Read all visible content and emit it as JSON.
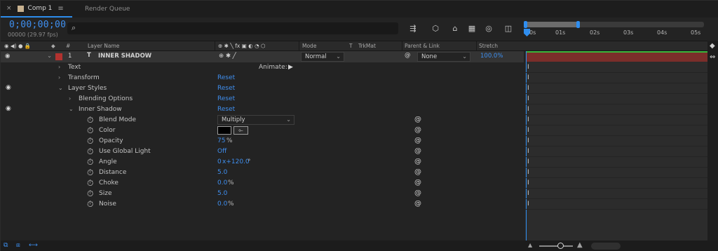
{
  "tabs": [
    {
      "label": "Comp 1",
      "active": true
    },
    {
      "label": "Render Queue",
      "active": false
    }
  ],
  "timecode": "0;00;00;00",
  "fps": "00000 (29.97 fps)",
  "search": {
    "placeholder": ""
  },
  "columns": {
    "num": "#",
    "layer_name": "Layer Name",
    "mode": "Mode",
    "t": "T",
    "trkmat": "TrkMat",
    "parent": "Parent & Link",
    "stretch": "Stretch"
  },
  "ruler": {
    "ticks": [
      "0s",
      "01s",
      "02s",
      "03s",
      "04s",
      "05s"
    ]
  },
  "layer": {
    "number": "1",
    "type_glyph": "T",
    "name": "INNER SHADOW",
    "color": "#b2322f",
    "mode": "Normal",
    "parent": "None",
    "stretch": "100.0%"
  },
  "properties": {
    "text": "Text",
    "animate_label": "Animate:",
    "transform": "Transform",
    "transform_reset": "Reset",
    "layer_styles": "Layer Styles",
    "layer_styles_reset": "Reset",
    "blending_options": "Blending Options",
    "blending_reset": "Reset",
    "inner_shadow": "Inner Shadow",
    "inner_shadow_reset": "Reset"
  },
  "inner_shadow_props": {
    "blend_mode": {
      "label": "Blend Mode",
      "value": "Multiply"
    },
    "color": {
      "label": "Color",
      "value": "#000000"
    },
    "opacity": {
      "label": "Opacity",
      "value": "75",
      "unit": "%"
    },
    "use_global_light": {
      "label": "Use Global Light",
      "value": "Off"
    },
    "angle": {
      "label": "Angle",
      "value": "0",
      "value2": "x+120.0",
      "unit": "°"
    },
    "distance": {
      "label": "Distance",
      "value": "5.0"
    },
    "choke": {
      "label": "Choke",
      "value": "0.0",
      "unit": "%"
    },
    "size": {
      "label": "Size",
      "value": "5.0"
    },
    "noise": {
      "label": "Noise",
      "value": "0.0",
      "unit": "%"
    }
  },
  "colors": {
    "accent": "#2f8ef0",
    "layer_label": "#b2322f",
    "layer_bar": "#7b2e2a",
    "in_out_line": "#39b63c"
  }
}
